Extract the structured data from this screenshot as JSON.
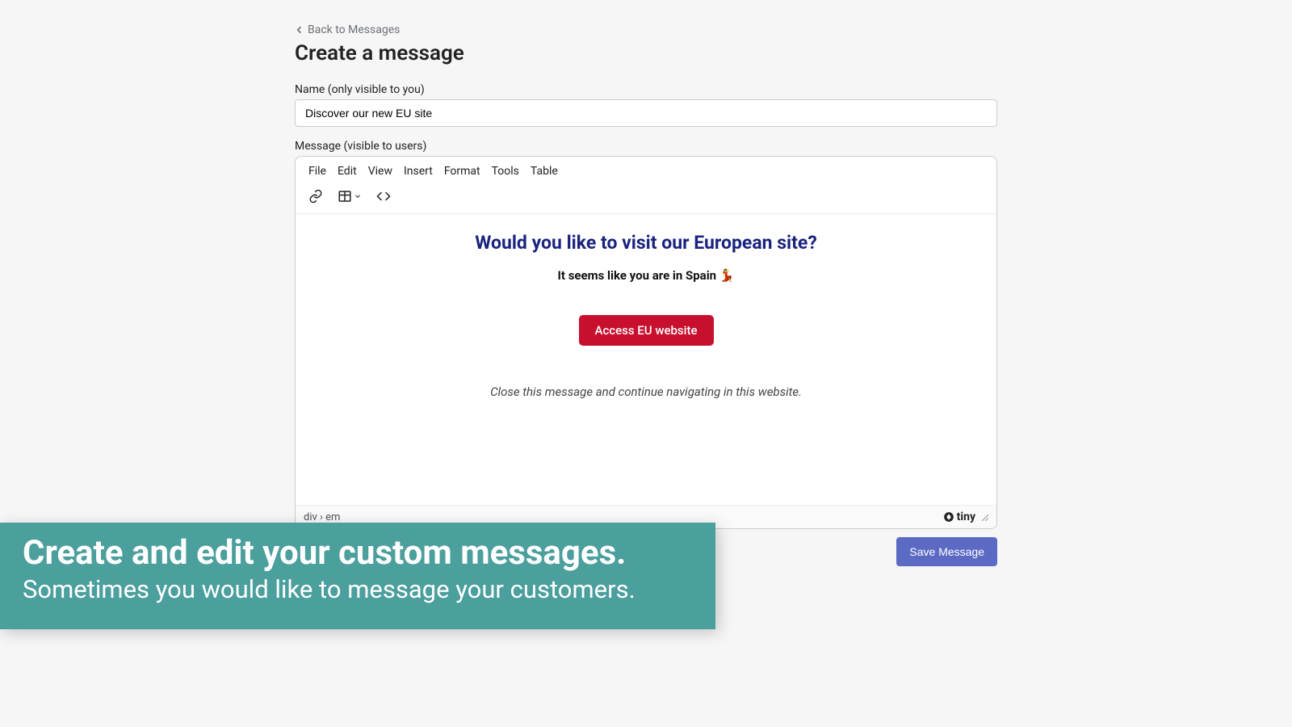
{
  "nav": {
    "back_label": "Back to Messages"
  },
  "page": {
    "title": "Create a message"
  },
  "fields": {
    "name_label": "Name (only visible to you)",
    "name_value": "Discover our new EU site",
    "message_label": "Message (visible to users)"
  },
  "editor": {
    "menubar": [
      "File",
      "Edit",
      "View",
      "Insert",
      "Format",
      "Tools",
      "Table"
    ],
    "content": {
      "headline": "Would you like to visit our European site?",
      "subline": "It seems like you are in Spain 💃",
      "cta_label": "Access EU website",
      "footnote": "Close this message and continue navigating in this website."
    },
    "statusbar_path": "div › em",
    "brand": "tiny"
  },
  "actions": {
    "save_label": "Save Message"
  },
  "overlay": {
    "title": "Create and edit your custom messages.",
    "subtitle": "Sometimes you would like to message your customers."
  }
}
